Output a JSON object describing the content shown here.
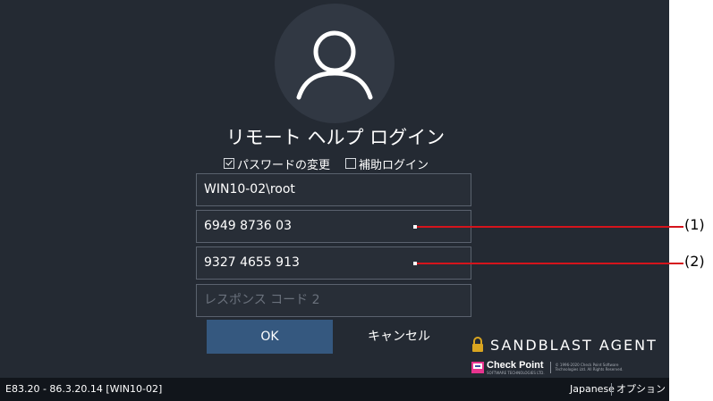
{
  "login": {
    "title": "リモート ヘルプ ログイン",
    "change_password_label": "パスワードの変更",
    "change_password_checked": true,
    "assisted_login_label": "補助ログイン",
    "assisted_login_checked": false,
    "username_value": "WIN10-02\\root",
    "challenge_code_1_value": "6949 8736 03",
    "challenge_code_2_value": "9327 4655 913",
    "response_code_2_placeholder": "レスポンス コード 2",
    "ok_label": "OK",
    "cancel_label": "キャンセル"
  },
  "branding": {
    "product_name": "SANDBLAST AGENT",
    "vendor_name": "Check Point",
    "vendor_tagline": "SOFTWARE TECHNOLOGIES LTD.",
    "copyright_line1": "© 1996-2020 Check Point Software",
    "copyright_line2": "Technologies Ltd. All Rights Reserved.",
    "accent_color": "#d9a520"
  },
  "status_bar": {
    "version": "E83.20 - 86.3.20.14 [WIN10-02]",
    "language": "Japanese",
    "options": "オプション"
  },
  "annotations": {
    "callout_1": "(1)",
    "callout_2": "(2)",
    "line_color": "#d5141c"
  },
  "icons": {
    "avatar": "user-icon",
    "brand": "padlock-icon",
    "vendor": "check-point-logo-icon"
  },
  "colors": {
    "background": "#242a33",
    "avatar_circle": "#313843",
    "primary_button": "#35587f",
    "status_bar": "#11151b",
    "field_border": "#5a626e"
  }
}
